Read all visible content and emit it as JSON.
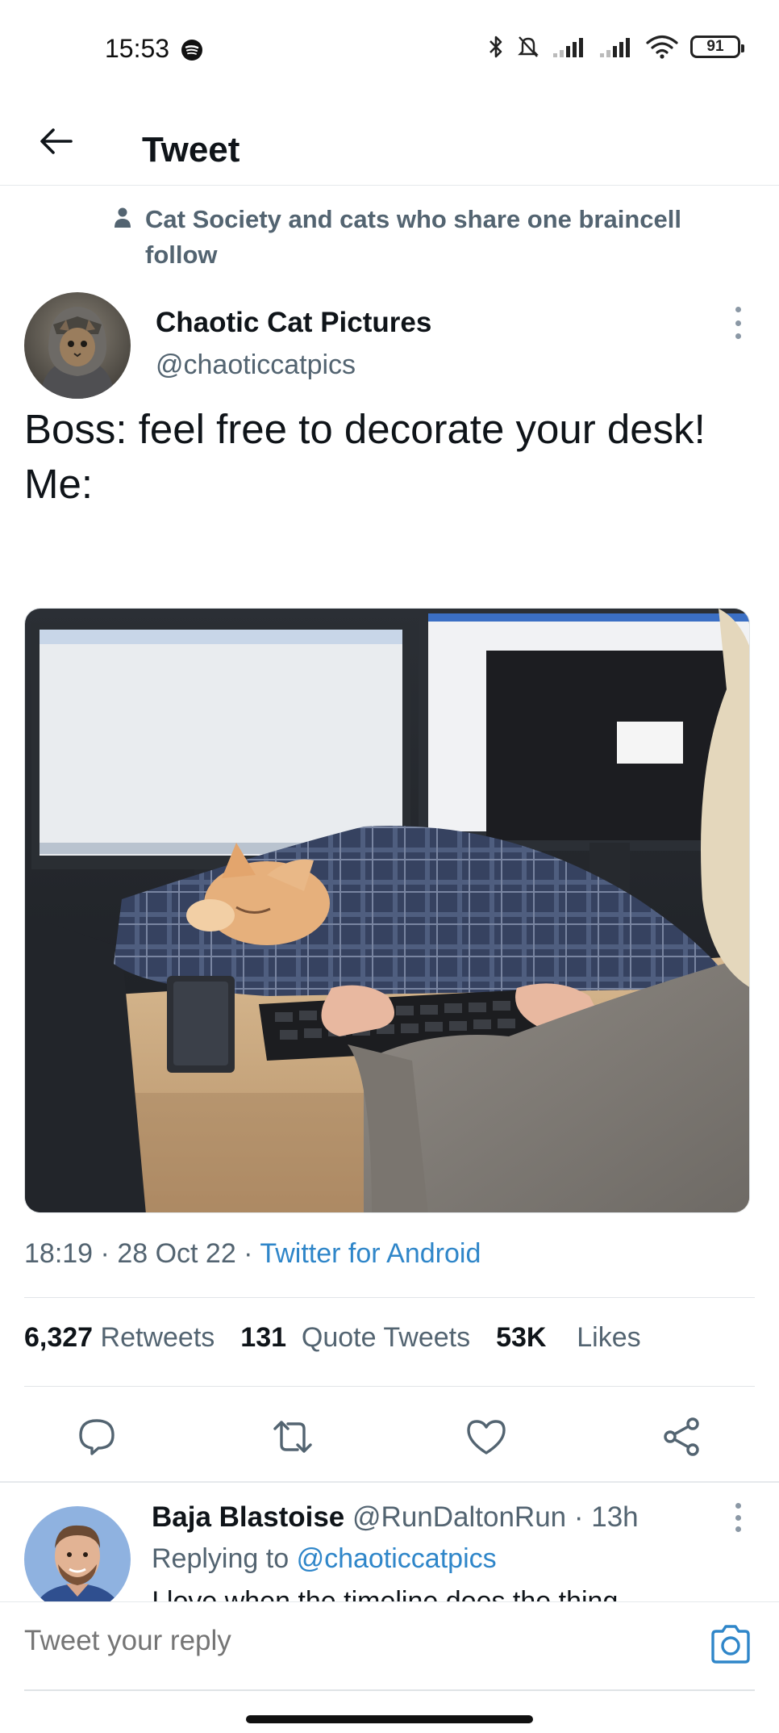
{
  "status_bar": {
    "time": "15:53",
    "battery": "91"
  },
  "header": {
    "title": "Tweet"
  },
  "social_context": {
    "text": "Cat Society and cats who share one braincell follow"
  },
  "tweet": {
    "author_name": "Chaotic Cat Pictures",
    "author_handle": "@chaoticcatpics",
    "text": "Boss: feel free to decorate your desk!\nMe:",
    "time": "18:19",
    "date": "28 Oct 22",
    "source": "Twitter for Android",
    "sep": " · ",
    "stats": {
      "retweets_count": "6,327",
      "retweets_label": "Retweets",
      "quotes_count": "131",
      "quotes_label": "Quote Tweets",
      "likes_count": "53K",
      "likes_label": "Likes"
    }
  },
  "actions": {
    "reply_icon": "reply-icon",
    "retweet_icon": "retweet-icon",
    "like_icon": "heart-icon",
    "share_icon": "share-icon"
  },
  "reply": {
    "name": "Baja Blastoise",
    "handle": "@RunDaltonRun",
    "time": "· 13h",
    "replying_prefix": "Replying to",
    "replying_mention": "@chaoticcatpics",
    "snippet": "I love when the timeline does the thing"
  },
  "composer": {
    "placeholder": "Tweet your reply"
  },
  "colors": {
    "link": "#2f86c9",
    "secondary": "#536471",
    "primary": "#0f1419"
  }
}
